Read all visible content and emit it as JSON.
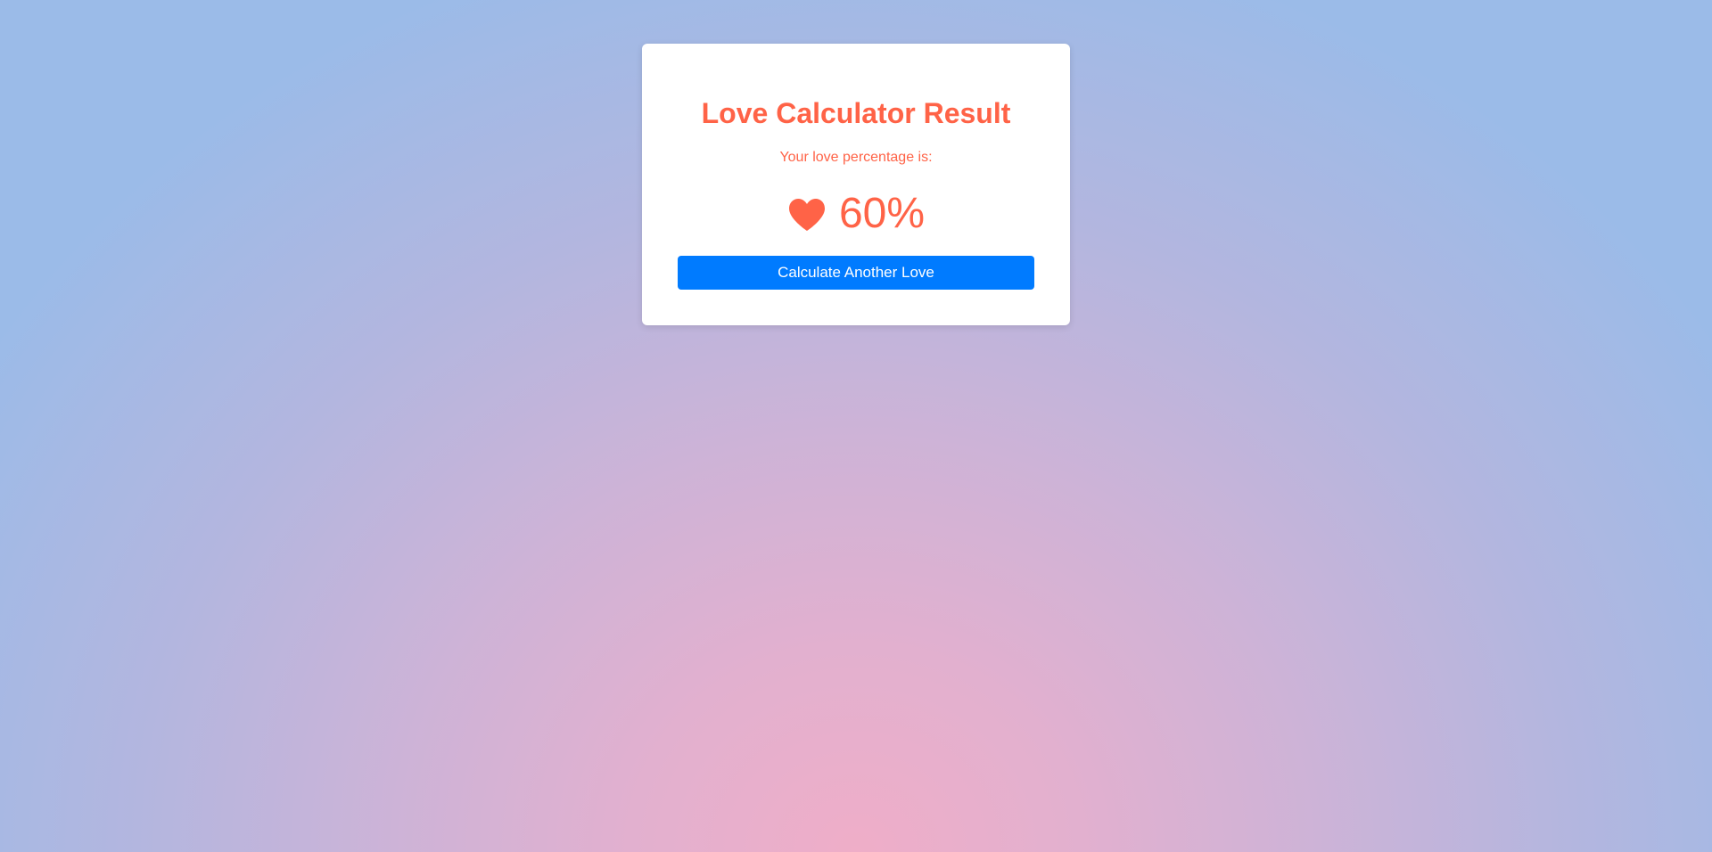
{
  "card": {
    "title": "Love Calculator Result",
    "subtitle": "Your love percentage is:",
    "result": {
      "icon": "heart-icon",
      "percentage": "60%"
    },
    "button_label": "Calculate Another Love"
  },
  "colors": {
    "accent": "#ff6347",
    "button": "#007bff",
    "card_background": "#ffffff"
  }
}
